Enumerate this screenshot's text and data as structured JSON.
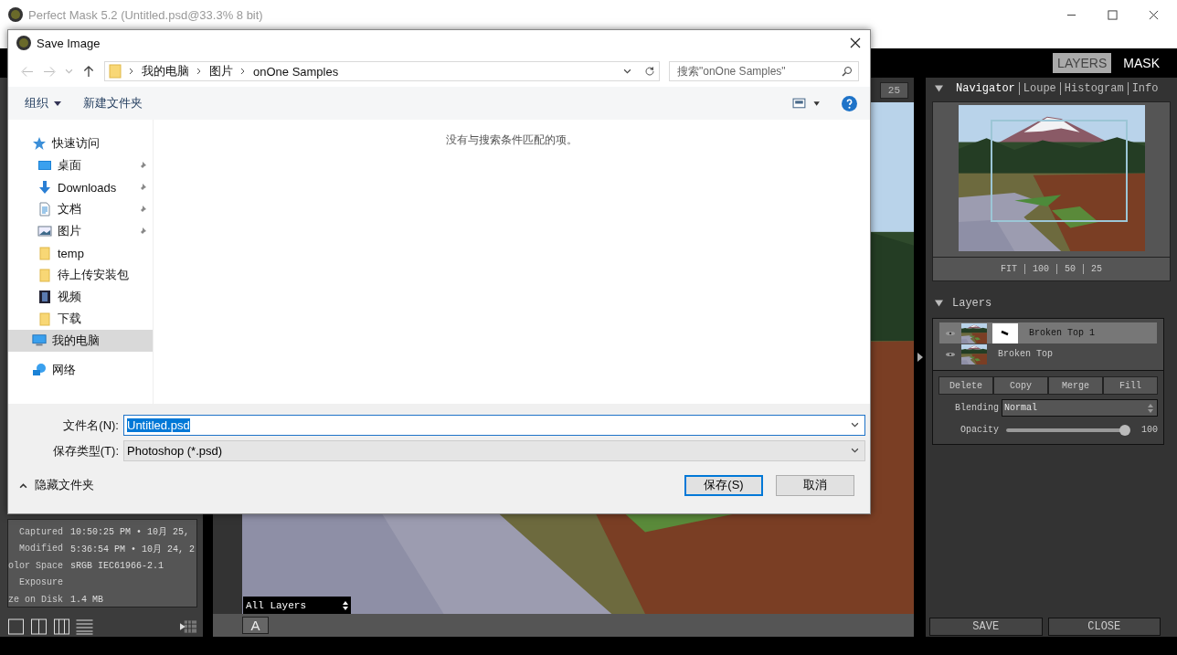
{
  "app_window": {
    "title": "Perfect Mask 5.2 (Untitled.psd@33.3% 8 bit)"
  },
  "mode_tabs": [
    {
      "label": "LAYERS",
      "selected": true
    },
    {
      "label": "MASK",
      "selected": false
    }
  ],
  "canvas": {
    "zoom_value": "25",
    "layer_select": "All Layers",
    "view_button": "A"
  },
  "info_panel": {
    "rows": [
      {
        "label": "Captured",
        "value": "10:50:25 PM • 10月 25,"
      },
      {
        "label": "Modified",
        "value": "5:36:54 PM • 10月 24, 2"
      },
      {
        "label": "olor Space",
        "value": "sRGB IEC61966-2.1"
      },
      {
        "label": "Exposure"
      },
      {
        "label": "ze on Disk",
        "value": "1.4 MB"
      }
    ]
  },
  "navigator": {
    "tabs": [
      {
        "label": "Navigator",
        "selected": true
      },
      {
        "label": "Loupe",
        "selected": false
      },
      {
        "label": "Histogram",
        "selected": false
      },
      {
        "label": "Info",
        "selected": false
      }
    ],
    "zoom_options": [
      "FIT",
      "100",
      "50",
      "25"
    ]
  },
  "layers_panel": {
    "title": "Layers",
    "layers": [
      {
        "name": "Broken Top 1",
        "selected": true,
        "has_mask": true
      },
      {
        "name": "Broken Top",
        "selected": false,
        "has_mask": false
      }
    ],
    "buttons": [
      "Delete",
      "Copy",
      "Merge",
      "Fill"
    ],
    "blending": {
      "label": "Blending",
      "value": "Normal"
    },
    "opacity": {
      "label": "Opacity",
      "level": 1,
      "reading": "100"
    }
  },
  "footer_buttons": [
    "SAVE",
    "CLOSE"
  ],
  "dialog": {
    "title": "Save Image",
    "breadcrumb": [
      "我的电脑",
      "图片",
      "onOne Samples"
    ],
    "search": {
      "placeholder": "搜索\"onOne Samples\""
    },
    "toolbar": {
      "organize": "组织",
      "new_folder": "新建文件夹"
    },
    "nav": [
      {
        "label": "快速访问",
        "kind": "star",
        "selected": false,
        "children": [
          {
            "label": "桌面",
            "kind": "desktop",
            "pinned": true,
            "selected": false
          },
          {
            "label": "Downloads",
            "kind": "download",
            "pinned": true,
            "selected": false
          },
          {
            "label": "文档",
            "kind": "document",
            "pinned": true,
            "selected": false
          },
          {
            "label": "图片",
            "kind": "pictures",
            "pinned": true,
            "selected": false
          },
          {
            "label": "temp",
            "kind": "folder",
            "pinned": false,
            "selected": false
          },
          {
            "label": "待上传安装包",
            "kind": "folder",
            "pinned": false,
            "selected": false
          },
          {
            "label": "视频",
            "kind": "video",
            "pinned": false,
            "selected": false
          },
          {
            "label": "下载",
            "kind": "folder",
            "pinned": false,
            "selected": false
          }
        ]
      },
      {
        "label": "我的电脑",
        "kind": "computer",
        "selected": true
      },
      {
        "label": "网络",
        "kind": "network",
        "selected": false
      }
    ],
    "empty_message": "没有与搜索条件匹配的项。",
    "file_name": {
      "label": "文件名(N):",
      "value": "Untitled.psd"
    },
    "file_type": {
      "label": "保存类型(T):",
      "value": "Photoshop (*.psd)"
    },
    "hide_folders": "隐藏文件夹",
    "buttons": [
      {
        "label": "保存(S)",
        "default": true
      },
      {
        "label": "取消",
        "default": false
      }
    ]
  }
}
